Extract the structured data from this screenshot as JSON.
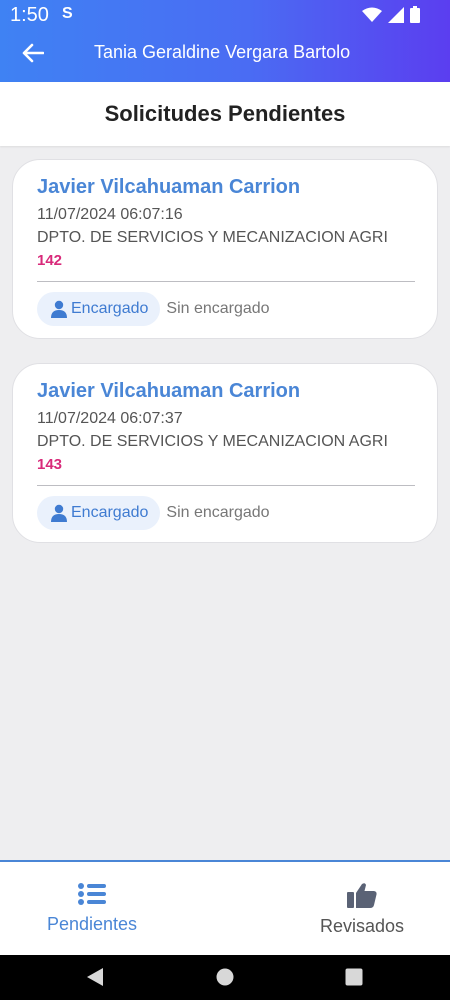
{
  "status": {
    "time": "1:50",
    "extra": "S"
  },
  "appbar": {
    "title": "Tania Geraldine Vergara Bartolo"
  },
  "page": {
    "title": "Solicitudes Pendientes"
  },
  "cards": [
    {
      "name": "Javier Vilcahuaman Carrion",
      "datetime": "11/07/2024 06:07:16",
      "department": "DPTO. DE SERVICIOS Y MECANIZACION AGRI",
      "number": "142",
      "chip_label": "Encargado",
      "assignee": "Sin encargado"
    },
    {
      "name": "Javier Vilcahuaman Carrion",
      "datetime": "11/07/2024 06:07:37",
      "department": "DPTO. DE SERVICIOS Y MECANIZACION AGRI",
      "number": "143",
      "chip_label": "Encargado",
      "assignee": "Sin encargado"
    }
  ],
  "bottom_nav": {
    "pendientes": "Pendientes",
    "revisados": "Revisados"
  },
  "colors": {
    "accent": "#4a86d6",
    "number": "#d82a7a",
    "appbar_start": "#3f82f3",
    "appbar_end": "#5b3ef0"
  }
}
